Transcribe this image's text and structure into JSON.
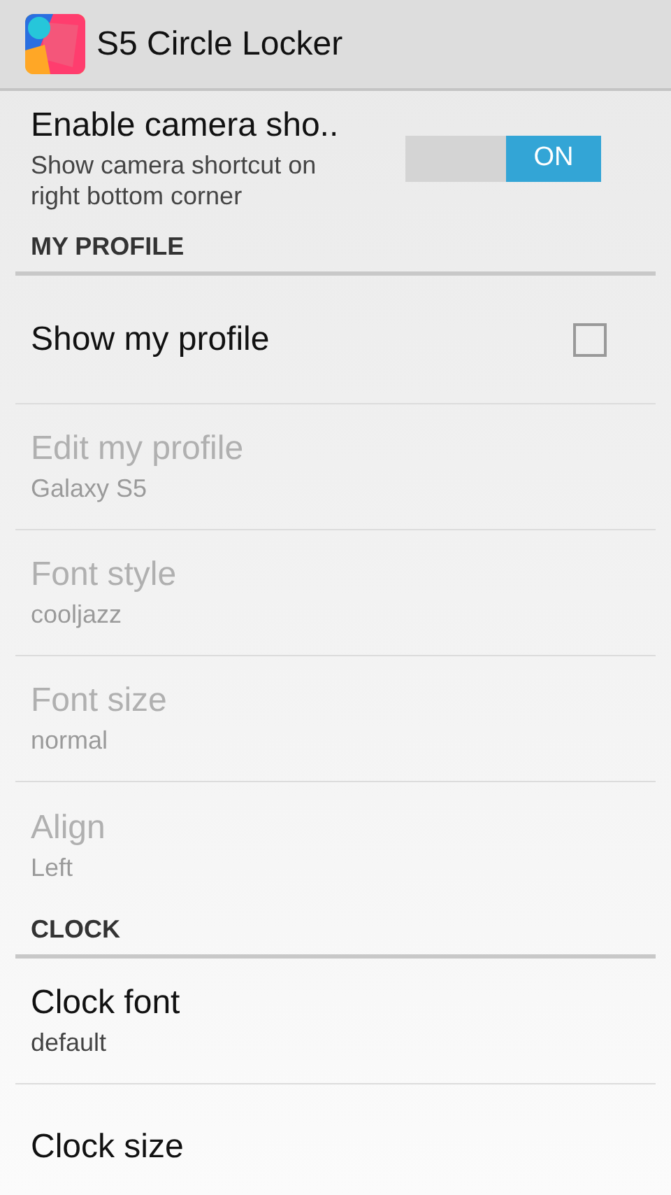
{
  "app_bar": {
    "title": "S5 Circle Locker"
  },
  "items": [
    {
      "kind": "switch",
      "title": "Enable camera sho..",
      "summary": "Show camera shortcut on right bottom corner",
      "on": true,
      "switch_label": "ON",
      "disabled": false
    },
    {
      "kind": "header",
      "title": "MY PROFILE"
    },
    {
      "kind": "checkbox",
      "title": "Show my profile",
      "checked": false,
      "disabled": false
    },
    {
      "kind": "pref",
      "title": "Edit my profile",
      "summary": "Galaxy S5",
      "disabled": true
    },
    {
      "kind": "pref",
      "title": "Font style",
      "summary": "cooljazz",
      "disabled": true
    },
    {
      "kind": "pref",
      "title": "Font size",
      "summary": "normal",
      "disabled": true
    },
    {
      "kind": "pref",
      "title": "Align",
      "summary": "Left",
      "disabled": true
    },
    {
      "kind": "header",
      "title": "CLOCK"
    },
    {
      "kind": "pref",
      "title": "Clock font",
      "summary": "default",
      "disabled": false
    },
    {
      "kind": "pref",
      "title": "Clock size",
      "disabled": false
    }
  ]
}
